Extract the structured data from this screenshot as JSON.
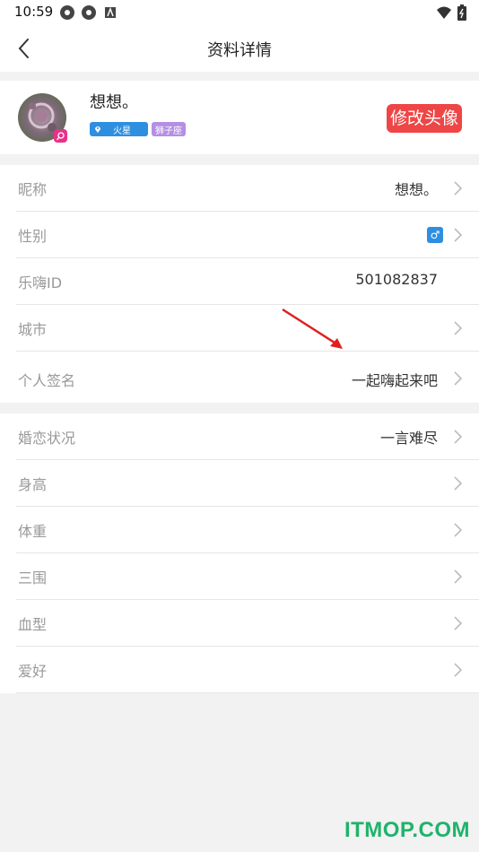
{
  "status_bar": {
    "time": "10:59"
  },
  "header": {
    "title": "资料详情"
  },
  "profile": {
    "name": "想想。",
    "location_tag": "火星",
    "zodiac_tag": "狮子座",
    "change_avatar_label": "修改头像"
  },
  "group1": [
    {
      "label": "昵称",
      "value": "想想。"
    },
    {
      "label": "性别",
      "value": "♂"
    },
    {
      "label": "乐嗨ID",
      "value": "501082837"
    },
    {
      "label": "城市",
      "value": ""
    },
    {
      "label": "个人签名",
      "value": "一起嗨起来吧"
    }
  ],
  "group2": [
    {
      "label": "婚恋状况",
      "value": "一言难尽"
    },
    {
      "label": "身高",
      "value": ""
    },
    {
      "label": "体重",
      "value": ""
    },
    {
      "label": "三围",
      "value": ""
    },
    {
      "label": "血型",
      "value": ""
    },
    {
      "label": "爱好",
      "value": ""
    }
  ],
  "watermark": "ITMOP.COM",
  "colors": {
    "accent_red": "#ee4646",
    "tag_blue": "#2e8fe0",
    "tag_purple": "#b48fe3",
    "watermark_green": "#1fb36b"
  }
}
